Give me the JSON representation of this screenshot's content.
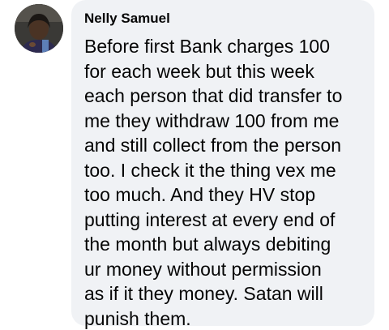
{
  "comment": {
    "author": "Nelly Samuel",
    "avatar_icon": "user-photo-avatar",
    "text": "Before first Bank charges 100\nfor each week  but this week\neach person that did transfer to\nme they withdraw 100 from me\nand still collect from the person\ntoo.  I check it the thing vex me\ntoo much. And they HV stop\nputting interest at every end of\nthe month but always debiting\nur money  without permission\nas if it they money. Satan will\npunish them.",
    "bubble_color": "#f0f2f5",
    "text_color": "#050505"
  }
}
